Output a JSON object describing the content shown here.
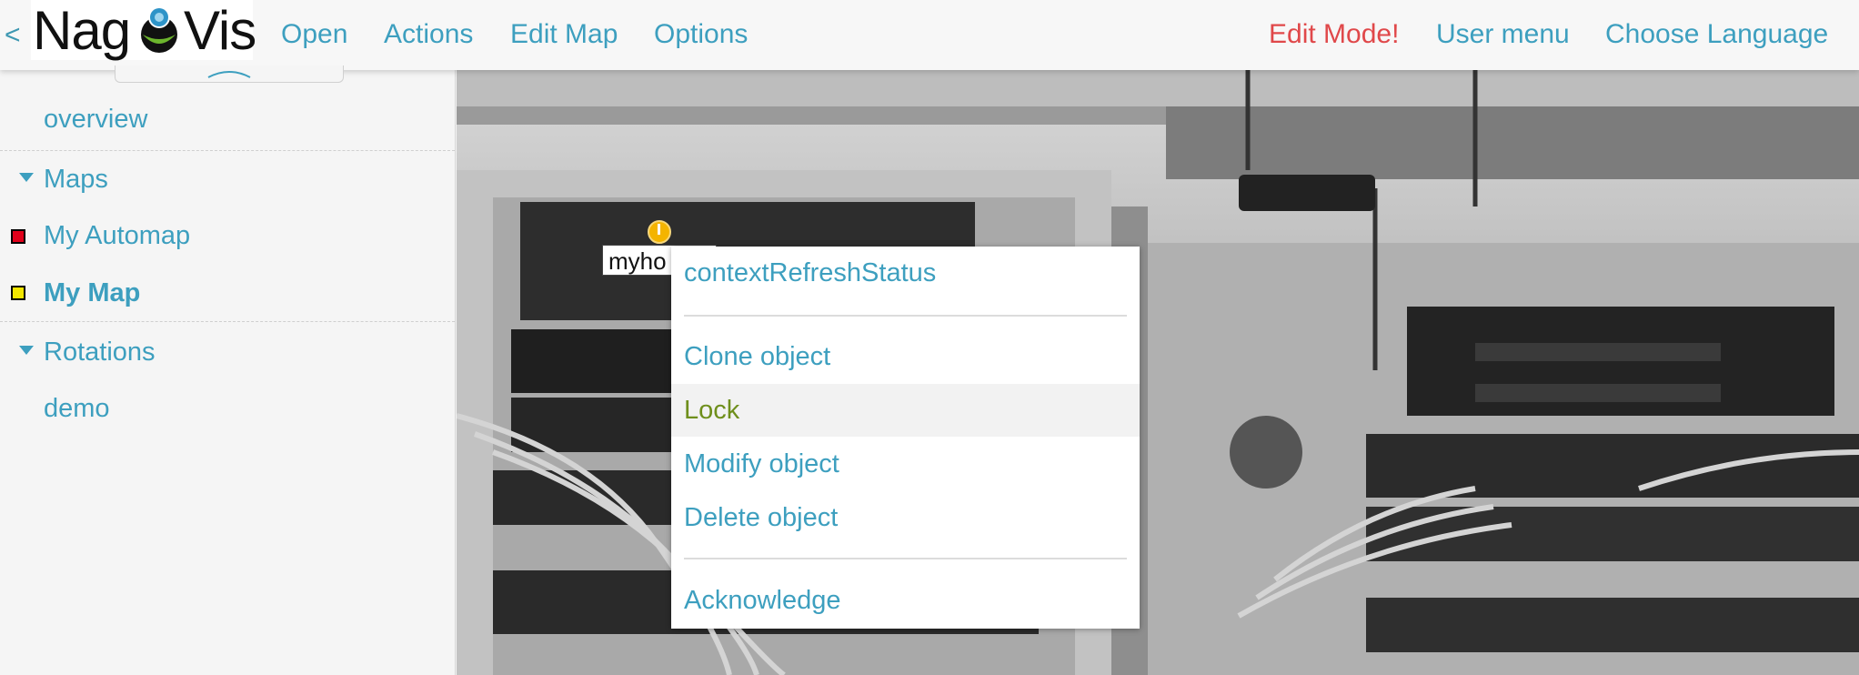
{
  "header": {
    "back": "<",
    "logo_left": "Nag",
    "logo_right": "Vis",
    "nav": [
      "Open",
      "Actions",
      "Edit Map",
      "Options"
    ],
    "right": {
      "edit_mode": "Edit Mode!",
      "user_menu": "User menu",
      "language": "Choose Language"
    },
    "colors": {
      "accent": "#3d9fbf",
      "warning": "#e0484a"
    }
  },
  "sidebar": {
    "overview": "overview",
    "maps_heading": "Maps",
    "maps": [
      {
        "label": "My Automap",
        "status_color": "#e0001a",
        "active": false
      },
      {
        "label": "My Map",
        "status_color": "#f2e600",
        "active": true
      }
    ],
    "rotations_heading": "Rotations",
    "rotations": [
      "demo"
    ]
  },
  "map": {
    "object_label": "myho",
    "object_icon": "warning-info-icon",
    "context_menu": {
      "items": [
        "contextRefreshStatus",
        "Clone object",
        "Lock",
        "Modify object",
        "Delete object",
        "Acknowledge"
      ],
      "highlighted": "Lock",
      "highlight_color": "#6f8f1c"
    }
  }
}
